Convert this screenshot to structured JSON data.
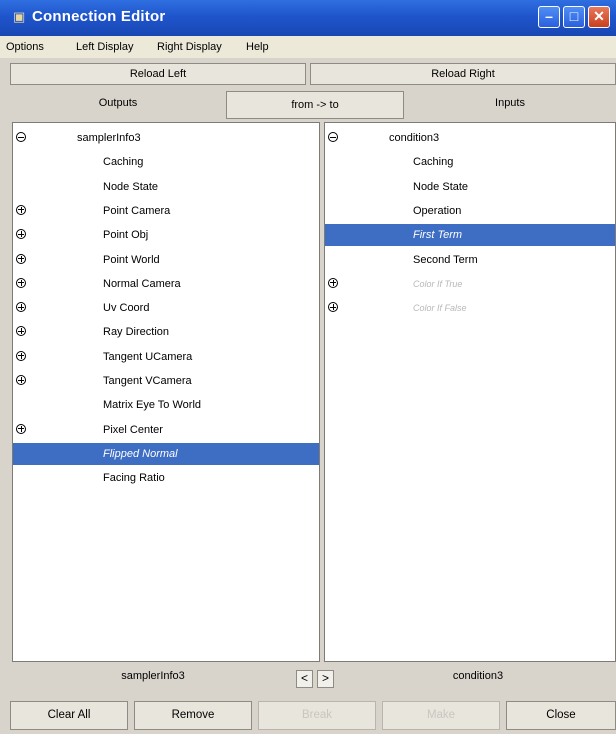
{
  "window": {
    "title": "Connection Editor",
    "title_icon": "connection-editor-app-icon"
  },
  "menu": [
    "Options",
    "Left Display",
    "Right Display",
    "Help"
  ],
  "reload": {
    "left": "Reload Left",
    "right": "Reload Right"
  },
  "header": {
    "outputs": "Outputs",
    "direction": "from -> to",
    "inputs": "Inputs"
  },
  "left_panel": {
    "rows": [
      {
        "label": "samplerInfo3",
        "expander": "collapse",
        "indent": 0
      },
      {
        "label": "Caching",
        "expander": "",
        "indent": 1
      },
      {
        "label": "Node State",
        "expander": "",
        "indent": 1
      },
      {
        "label": "Point Camera",
        "expander": "expand",
        "indent": 1
      },
      {
        "label": "Point Obj",
        "expander": "expand",
        "indent": 1
      },
      {
        "label": "Point World",
        "expander": "expand",
        "indent": 1
      },
      {
        "label": "Normal Camera",
        "expander": "expand",
        "indent": 1
      },
      {
        "label": "Uv Coord",
        "expander": "expand",
        "indent": 1
      },
      {
        "label": "Ray Direction",
        "expander": "expand",
        "indent": 1
      },
      {
        "label": "Tangent UCamera",
        "expander": "expand",
        "indent": 1
      },
      {
        "label": "Tangent VCamera",
        "expander": "expand",
        "indent": 1
      },
      {
        "label": "Matrix Eye To World",
        "expander": "",
        "indent": 1
      },
      {
        "label": "Pixel Center",
        "expander": "expand",
        "indent": 1
      },
      {
        "label": "Flipped Normal",
        "expander": "",
        "indent": 1,
        "selected": true
      },
      {
        "label": "Facing Ratio",
        "expander": "",
        "indent": 1
      }
    ]
  },
  "right_panel": {
    "rows": [
      {
        "label": "condition3",
        "expander": "collapse",
        "indent": 0
      },
      {
        "label": "Caching",
        "expander": "",
        "indent": 1
      },
      {
        "label": "Node State",
        "expander": "",
        "indent": 1
      },
      {
        "label": "Operation",
        "expander": "",
        "indent": 1
      },
      {
        "label": "First Term",
        "expander": "",
        "indent": 1,
        "selected": true
      },
      {
        "label": "Second Term",
        "expander": "",
        "indent": 1
      },
      {
        "label": "Color If True",
        "expander": "expand",
        "indent": 1,
        "dim": true
      },
      {
        "label": "Color If False",
        "expander": "expand",
        "indent": 1,
        "dim": true
      }
    ]
  },
  "footer": {
    "left_node": "samplerInfo3",
    "right_node": "condition3",
    "prev": "<",
    "next": ">"
  },
  "buttons": [
    {
      "label": "Clear All",
      "enabled": true
    },
    {
      "label": "Remove",
      "enabled": true
    },
    {
      "label": "Break",
      "enabled": false
    },
    {
      "label": "Make",
      "enabled": false
    },
    {
      "label": "Close",
      "enabled": true
    }
  ],
  "colors": {
    "title_bar": "#2058d0",
    "selection": "#3e6dc4",
    "close_button": "#d04a26"
  }
}
